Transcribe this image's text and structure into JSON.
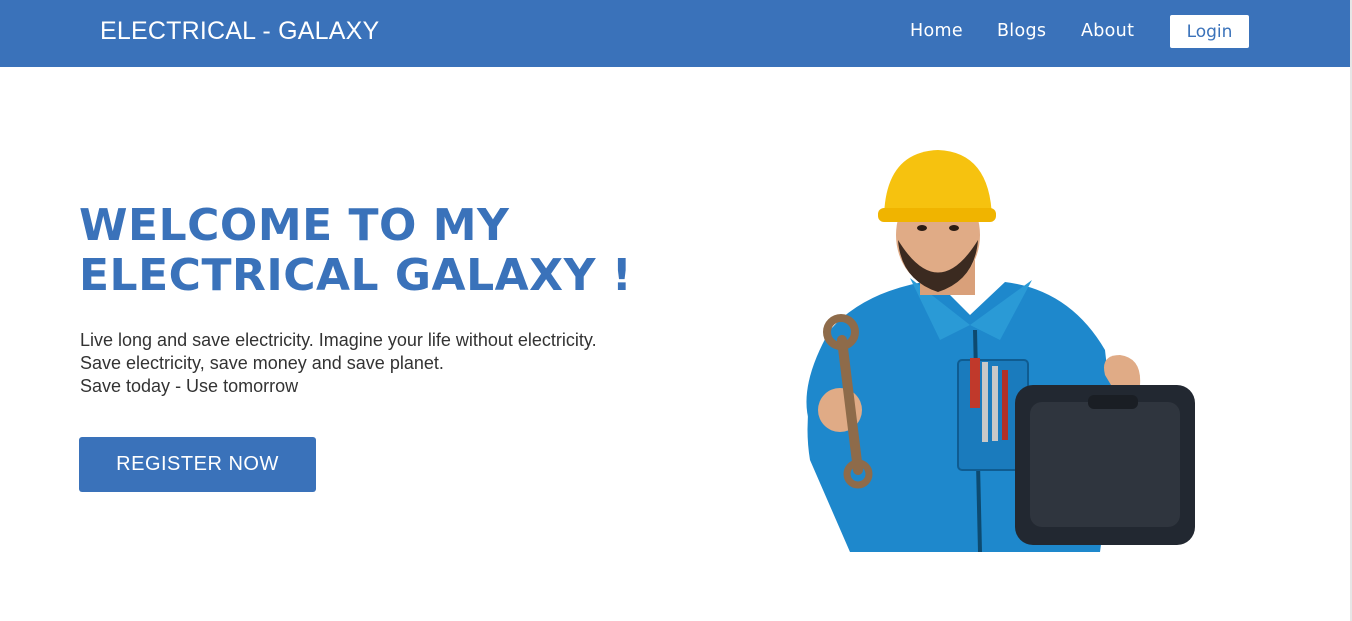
{
  "nav": {
    "brand": "ELECTRICAL - GALAXY",
    "links": [
      "Home",
      "Blogs",
      "About"
    ],
    "login_label": "Login"
  },
  "hero": {
    "title": "WELCOME TO MY ELECTRICAL GALAXY !",
    "lines": [
      "Live long and save electricity. Imagine your life without electricity.",
      "Save electricity, save money and save planet.",
      "Save today - Use tomorrow"
    ],
    "cta_label": "REGISTER  NOW",
    "image": "electrician-with-toolbox"
  },
  "colors": {
    "brand_blue": "#3a72ba",
    "white": "#ffffff",
    "text_dark": "#333333"
  }
}
